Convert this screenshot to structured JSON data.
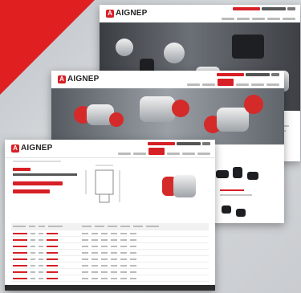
{
  "brand": {
    "logo_mark": "A",
    "logo_text": "AIGNEP"
  },
  "screens": [
    {
      "id": "home"
    },
    {
      "id": "category"
    },
    {
      "id": "product"
    }
  ],
  "colors": {
    "accent": "#d71f26",
    "corner": "#e02020"
  }
}
